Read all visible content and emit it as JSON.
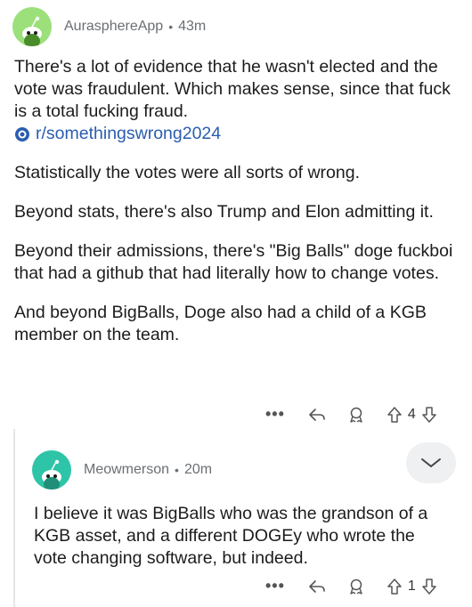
{
  "comment": {
    "username": "AurasphereApp",
    "time": "43m",
    "paragraphs": [
      "There's a lot of evidence that he wasn't elected and the vote was fraudulent.  Which makes sense, since that fuck is a total fucking fraud.",
      "Statistically the votes were all sorts of wrong.",
      "Beyond stats, there's also Trump and Elon admitting it.",
      "Beyond their admissions, there's \"Big Balls\" doge fuckboi that had a github that had literally how to change votes.",
      "And beyond BigBalls, Doge also had a child of a KGB member on the team."
    ],
    "subreddit_link": "r/somethingswrong2024",
    "vote_count": "4"
  },
  "reply": {
    "username": "Meowmerson",
    "time": "20m",
    "text": "I believe it was BigBalls who was the grandson of a KGB asset, and a different DOGEy who wrote the vote changing software, but indeed.",
    "vote_count": "1"
  },
  "icons": {
    "more": "more-dots-icon",
    "reply": "reply-arrow-icon",
    "award": "award-icon",
    "upvote": "upvote-arrow-icon",
    "downvote": "downvote-arrow-icon",
    "collapse": "chevron-down-icon",
    "subreddit": "subreddit-icon"
  },
  "colors": {
    "link": "#2a5db0",
    "avatar_green": "#9be07a",
    "avatar_teal": "#2ec4a8"
  }
}
